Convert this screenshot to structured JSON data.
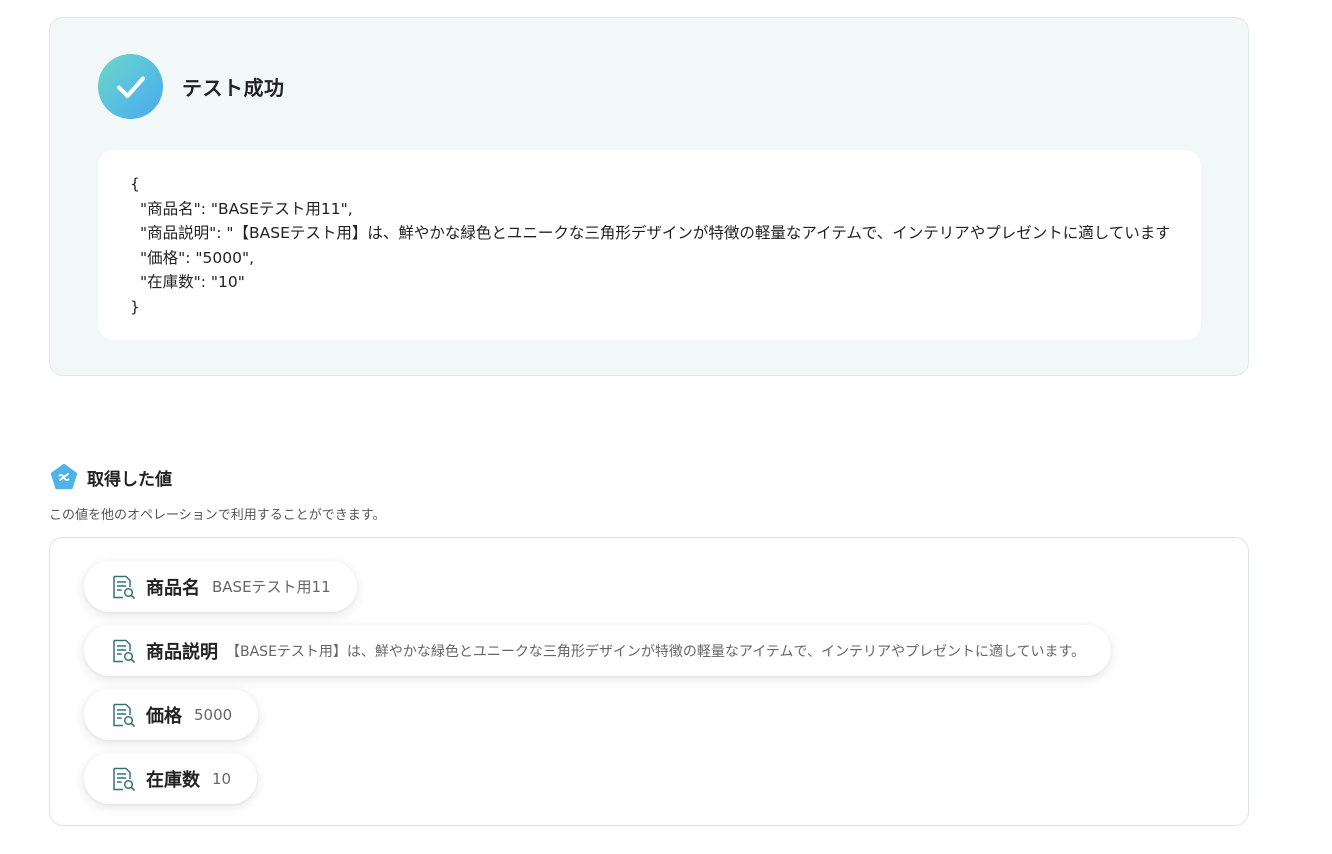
{
  "test_result": {
    "title": "テスト成功",
    "json_lines": [
      "{",
      "\"商品名\": \"BASEテスト用11\",",
      "\"商品説明\": \"【BASEテスト用】は、鮮やかな緑色とユニークな三角形デザインが特徴の軽量なアイテムで、インテリアやプレゼントに適しています。\",",
      "\"価格\": \"5000\",",
      "\"在庫数\": \"10\"",
      "}"
    ]
  },
  "retrieved": {
    "title": "取得した値",
    "description": "この値を他のオペレーションで利用することができます。",
    "items": [
      {
        "label": "商品名",
        "value": "BASEテスト用11"
      },
      {
        "label": "商品説明",
        "value": "【BASEテスト用】は、鮮やかな緑色とユニークな三角形デザインが特徴の軽量なアイテムで、インテリアやプレゼントに適しています。"
      },
      {
        "label": "価格",
        "value": "5000"
      },
      {
        "label": "在庫数",
        "value": "10"
      }
    ]
  },
  "colors": {
    "card_bg": "#f2f8f8",
    "accent": "#56bfe2",
    "icon_teal": "#3a6f7a"
  },
  "icons": {
    "success": "check-circle-icon",
    "section": "variable-pentagon-icon",
    "chip": "document-search-icon"
  }
}
